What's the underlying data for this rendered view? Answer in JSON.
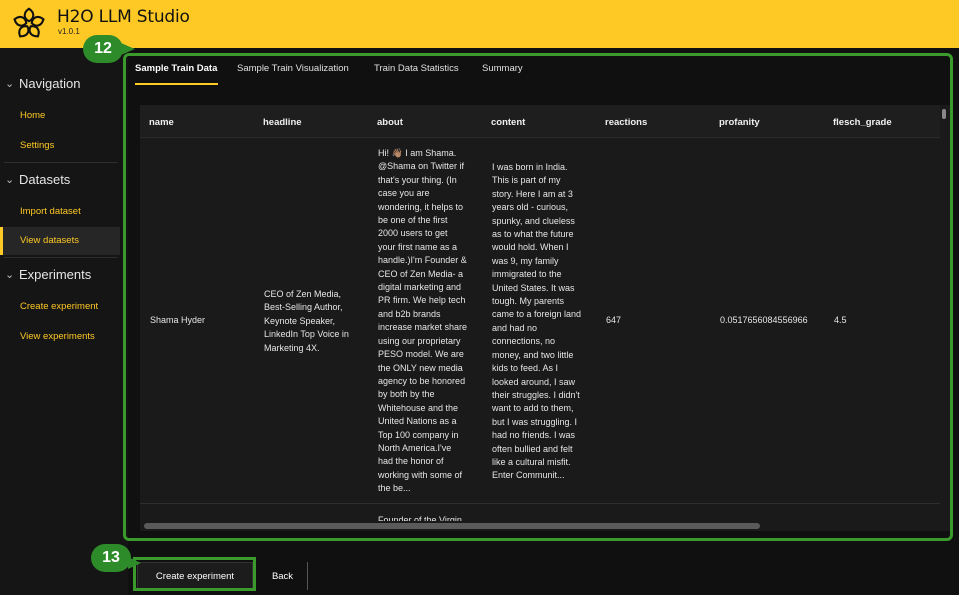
{
  "app": {
    "title": "H2O LLM Studio",
    "version": "v1.0.1"
  },
  "sidebar": {
    "groups": [
      {
        "label": "Navigation",
        "items": [
          {
            "label": "Home"
          },
          {
            "label": "Settings"
          }
        ]
      },
      {
        "label": "Datasets",
        "items": [
          {
            "label": "Import dataset"
          },
          {
            "label": "View datasets",
            "active": true
          }
        ]
      },
      {
        "label": "Experiments",
        "items": [
          {
            "label": "Create experiment"
          },
          {
            "label": "View experiments"
          }
        ]
      }
    ]
  },
  "tabs": [
    {
      "label": "Sample Train Data",
      "active": true
    },
    {
      "label": "Sample Train Visualization"
    },
    {
      "label": "Train Data Statistics"
    },
    {
      "label": "Summary"
    }
  ],
  "table": {
    "columns": [
      "name",
      "headline",
      "about",
      "content",
      "reactions",
      "profanity",
      "flesch_grade"
    ],
    "rows": [
      {
        "name": "Shama Hyder",
        "headline": "CEO of Zen Media,\nBest-Selling Author,\nKeynote Speaker,\nLinkedIn Top Voice in\nMarketing 4X.",
        "about": "Hi! 👋🏽 I am Shama.\n@Shama on Twitter if\nthat's your thing. (In\ncase you are\nwondering, it helps to\nbe one of the first\n2000 users to get\nyour first name as a\nhandle.)I'm Founder &\nCEO of Zen Media- a\ndigital marketing and\nPR firm. We help tech\nand b2b brands\nincrease market share\nusing our proprietary\nPESO model. We are\nthe ONLY new media\nagency to be honored\nby both by the\nWhitehouse and the\nUnited Nations as a\nTop 100 company in\nNorth America.I've\nhad the honor of\nworking with some of\nthe be...",
        "content": "I was born in India.\nThis is part of my\nstory.  Here I am at 3\nyears old - curious,\nspunky, and clueless\nas to what the future\nwould hold. When I\nwas 9, my family\nimmigrated to the\nUnited States.   It was\ntough. My parents\ncame to a foreign land\nand had no\nconnections, no\nmoney, and two little\nkids to feed.   As I\nlooked around, I saw\ntheir struggles. I didn't\nwant to add to them,\nbut I was struggling. I\nhad no friends. I was\noften bullied and felt\nlike a cultural misfit.\nEnter Communit...",
        "reactions": "647",
        "profanity": "0.0517656084556966",
        "flesch_grade": "4.5"
      },
      {
        "about": "Founder of the Virgin"
      }
    ]
  },
  "footer": {
    "create_label": "Create experiment",
    "back_label": "Back"
  },
  "annotations": [
    {
      "label": "12"
    },
    {
      "label": "13"
    }
  ],
  "colors": {
    "accent": "#fec925",
    "highlight": "#3a9a2c",
    "background": "#101010"
  }
}
